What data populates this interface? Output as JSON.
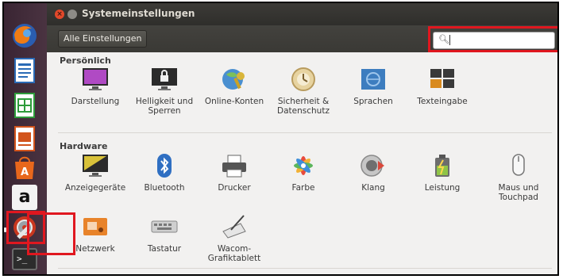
{
  "window": {
    "title": "Systemeinstellungen"
  },
  "toolbar": {
    "all_settings_label": "Alle Einstellungen",
    "search_value": ""
  },
  "sections": {
    "personal": {
      "heading": "Persönlich",
      "items": [
        "Darstellung",
        "Helligkeit und Sperren",
        "Online-Konten",
        "Sicherheit & Datenschutz",
        "Sprachen",
        "Texteingabe"
      ]
    },
    "hardware": {
      "heading": "Hardware",
      "items": [
        "Anzeigegeräte",
        "Bluetooth",
        "Drucker",
        "Farbe",
        "Klang",
        "Leistung",
        "Maus und Touchpad",
        "Netzwerk",
        "Tastatur",
        "Wacom-Grafiktablett"
      ]
    }
  },
  "launcher": {
    "items": [
      "firefox-icon",
      "writer-icon",
      "calc-icon",
      "impress-icon",
      "software-center-icon",
      "amazon-icon",
      "system-settings-icon",
      "terminal-icon"
    ],
    "amazon_glyph": "a",
    "terminal_glyph": ">_"
  },
  "colors": {
    "highlight": "#e0171f",
    "accent": "#dd4814"
  }
}
